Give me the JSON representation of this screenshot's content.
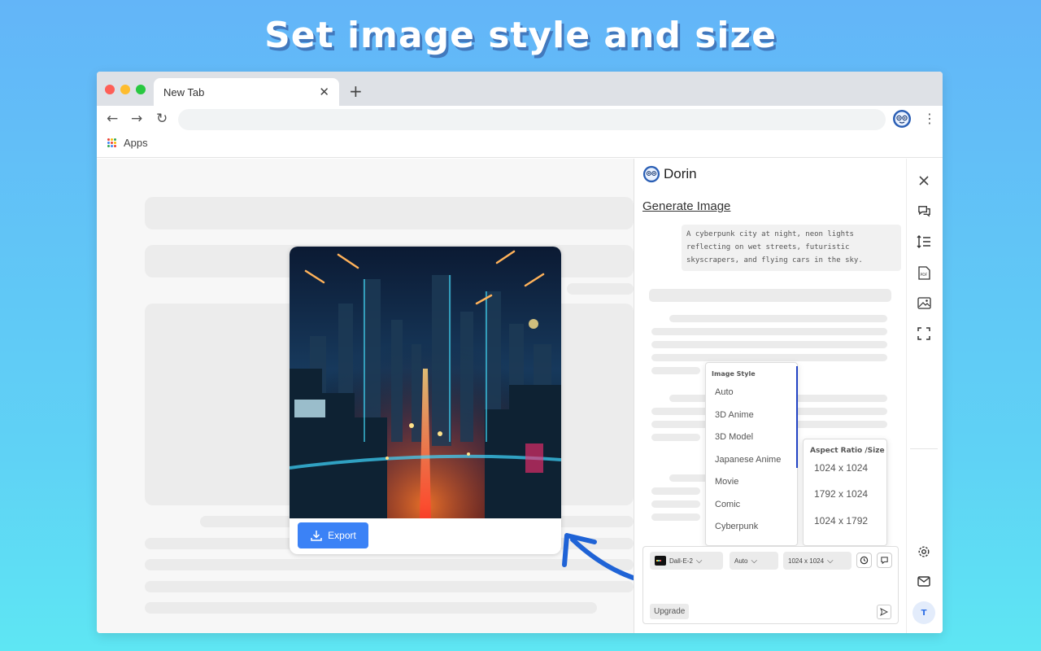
{
  "headline": "Set image style and size",
  "browser": {
    "tab_title": "New Tab",
    "tab_close": "✕",
    "new_tab": "+",
    "back": "←",
    "forward": "→",
    "reload": "↻",
    "menu": "⋮",
    "bookmark_apps": "Apps"
  },
  "image_card": {
    "export_label": "Export"
  },
  "panel": {
    "brand": "Dorin",
    "section_title": "Generate Image",
    "prompt": "A cyberpunk city at night, neon lights reflecting on wet streets, futuristic skyscrapers, and flying cars in the sky.",
    "style_menu": {
      "title": "Image Style",
      "options": [
        "Auto",
        "3D Anime",
        "3D Model",
        "Japanese Anime",
        "Movie",
        "Comic",
        "Cyberpunk"
      ]
    },
    "size_menu": {
      "title": "Aspect Ratio /Size",
      "options": [
        "1024 x 1024",
        "1792 x 1024",
        "1024 x 1792"
      ]
    },
    "composer": {
      "model": "Dall-E-2",
      "style": "Auto",
      "size": "1024 x 1024",
      "upgrade": "Upgrade"
    }
  },
  "rail": {
    "avatar_initial": "T"
  },
  "colors": {
    "accent": "#3b82f6",
    "arrow": "#1f63d6",
    "menu_edge": "#2243c4"
  },
  "icons": [
    "close-icon",
    "chat-icon",
    "line-spacing-icon",
    "pdf-icon",
    "image-icon",
    "screenshot-icon",
    "settings-icon",
    "mail-icon",
    "download-icon",
    "send-icon",
    "chevron-down-icon"
  ]
}
